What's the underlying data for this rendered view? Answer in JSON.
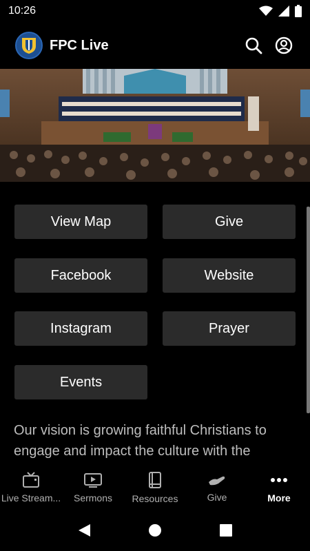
{
  "status_bar": {
    "time": "10:26"
  },
  "app_bar": {
    "title": "FPC Live"
  },
  "buttons": [
    {
      "label": "View Map"
    },
    {
      "label": "Give"
    },
    {
      "label": "Facebook"
    },
    {
      "label": "Website"
    },
    {
      "label": "Instagram"
    },
    {
      "label": "Prayer"
    },
    {
      "label": "Events"
    }
  ],
  "vision_text": "Our vision is growing faithful Christians to engage and impact the culture with the",
  "bottom_nav": [
    {
      "label": "Live Stream...",
      "icon": "tv-icon",
      "active": false
    },
    {
      "label": "Sermons",
      "icon": "video-icon",
      "active": false
    },
    {
      "label": "Resources",
      "icon": "book-icon",
      "active": false
    },
    {
      "label": "Give",
      "icon": "hand-icon",
      "active": false
    },
    {
      "label": "More",
      "icon": "more-dots-icon",
      "active": true
    }
  ],
  "colors": {
    "background": "#000000",
    "button": "#2b2b2b",
    "logo": "#1d4f91"
  }
}
